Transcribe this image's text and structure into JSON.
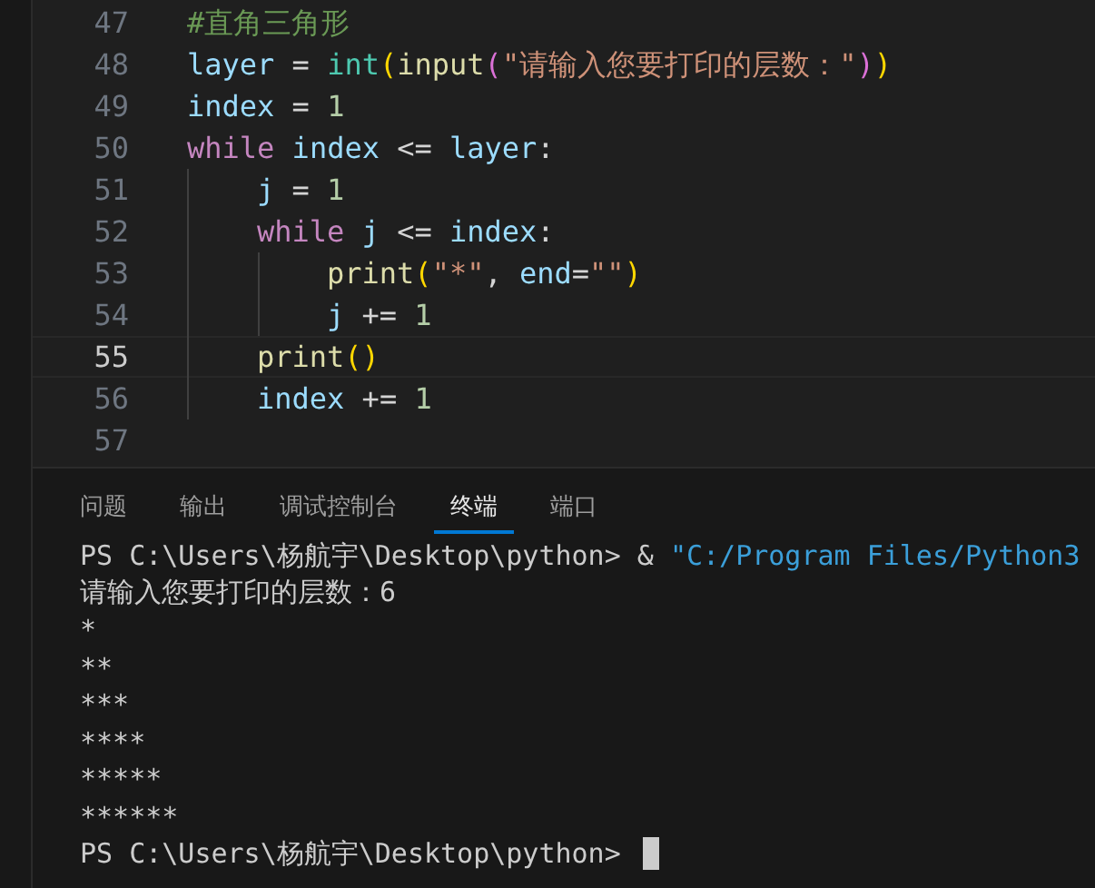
{
  "editor": {
    "lines": [
      {
        "number": "47",
        "current": false,
        "tokens": [
          {
            "kind": "comment",
            "text": "#直角三角形"
          }
        ]
      },
      {
        "number": "48",
        "current": false,
        "tokens": [
          {
            "kind": "variable",
            "text": "layer"
          },
          {
            "kind": "operator",
            "text": " = "
          },
          {
            "kind": "builtin",
            "text": "int"
          },
          {
            "kind": "bracket1",
            "text": "("
          },
          {
            "kind": "function",
            "text": "input"
          },
          {
            "kind": "bracket2",
            "text": "("
          },
          {
            "kind": "string",
            "text": "\"请输入您要打印的层数：\""
          },
          {
            "kind": "bracket2",
            "text": ")"
          },
          {
            "kind": "bracket1",
            "text": ")"
          }
        ]
      },
      {
        "number": "49",
        "current": false,
        "tokens": [
          {
            "kind": "variable",
            "text": "index"
          },
          {
            "kind": "operator",
            "text": " = "
          },
          {
            "kind": "number",
            "text": "1"
          }
        ]
      },
      {
        "number": "50",
        "current": false,
        "tokens": [
          {
            "kind": "keyword",
            "text": "while"
          },
          {
            "kind": "variable",
            "text": " index"
          },
          {
            "kind": "operator",
            "text": " <= "
          },
          {
            "kind": "variable",
            "text": "layer"
          },
          {
            "kind": "operator",
            "text": ":"
          }
        ],
        "children": [
          {
            "number": "51",
            "current": false,
            "tokens": [
              {
                "kind": "variable",
                "text": "j"
              },
              {
                "kind": "operator",
                "text": " = "
              },
              {
                "kind": "number",
                "text": "1"
              }
            ]
          },
          {
            "number": "52",
            "current": false,
            "tokens": [
              {
                "kind": "keyword",
                "text": "while"
              },
              {
                "kind": "variable",
                "text": " j"
              },
              {
                "kind": "operator",
                "text": " <= "
              },
              {
                "kind": "variable",
                "text": "index"
              },
              {
                "kind": "operator",
                "text": ":"
              }
            ],
            "children": [
              {
                "number": "53",
                "current": false,
                "tokens": [
                  {
                    "kind": "function",
                    "text": "print"
                  },
                  {
                    "kind": "bracket1",
                    "text": "("
                  },
                  {
                    "kind": "string",
                    "text": "\"*\""
                  },
                  {
                    "kind": "operator",
                    "text": ", "
                  },
                  {
                    "kind": "variable",
                    "text": "end"
                  },
                  {
                    "kind": "operator",
                    "text": "="
                  },
                  {
                    "kind": "string",
                    "text": "\"\""
                  },
                  {
                    "kind": "bracket1",
                    "text": ")"
                  }
                ]
              },
              {
                "number": "54",
                "current": false,
                "tokens": [
                  {
                    "kind": "variable",
                    "text": "j"
                  },
                  {
                    "kind": "operator",
                    "text": " += "
                  },
                  {
                    "kind": "number",
                    "text": "1"
                  }
                ]
              }
            ]
          },
          {
            "number": "55",
            "current": true,
            "tokens": [
              {
                "kind": "function",
                "text": "print"
              },
              {
                "kind": "bracket1",
                "text": "()"
              }
            ]
          },
          {
            "number": "56",
            "current": false,
            "tokens": [
              {
                "kind": "variable",
                "text": "index"
              },
              {
                "kind": "operator",
                "text": " += "
              },
              {
                "kind": "number",
                "text": "1"
              }
            ]
          }
        ]
      },
      {
        "number": "57",
        "current": false
      }
    ]
  },
  "panel": {
    "tabs": [
      {
        "label": "问题",
        "selected": false
      },
      {
        "label": "输出",
        "selected": false
      },
      {
        "label": "调试控制台",
        "selected": false
      },
      {
        "label": "终端",
        "selected": true
      },
      {
        "label": "端口",
        "selected": false
      }
    ],
    "terminal": {
      "lines": [
        {
          "tokens": [
            {
              "kind": "text",
              "text": "PS C:\\Users\\杨航宇\\Desktop\\python> & "
            },
            {
              "kind": "string",
              "text": "\"C:/Program Files/Python3"
            }
          ]
        },
        {
          "tokens": [
            {
              "kind": "text",
              "text": "请输入您要打印的层数：6"
            }
          ]
        },
        {
          "tokens": [
            {
              "kind": "text",
              "text": "*"
            }
          ]
        },
        {
          "tokens": [
            {
              "kind": "text",
              "text": "**"
            }
          ]
        },
        {
          "tokens": [
            {
              "kind": "text",
              "text": "***"
            }
          ]
        },
        {
          "tokens": [
            {
              "kind": "text",
              "text": "****"
            }
          ]
        },
        {
          "tokens": [
            {
              "kind": "text",
              "text": "*****"
            }
          ]
        },
        {
          "tokens": [
            {
              "kind": "text",
              "text": "******"
            }
          ]
        },
        {
          "tokens": [
            {
              "kind": "text",
              "text": "PS C:\\Users\\杨航宇\\Desktop\\python>"
            }
          ],
          "cursor": true
        }
      ]
    }
  }
}
